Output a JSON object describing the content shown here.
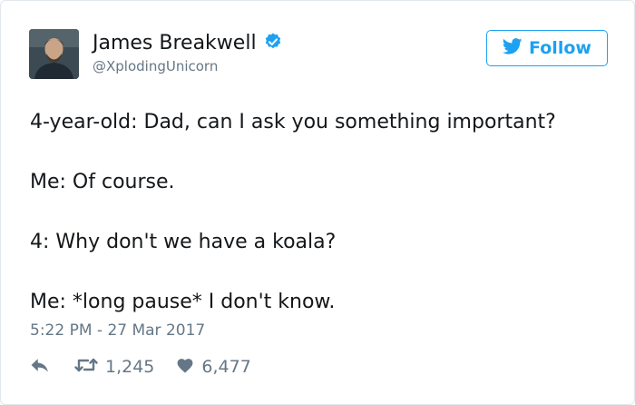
{
  "author": {
    "name": "James Breakwell",
    "handle": "@XplodingUnicorn",
    "verified": true
  },
  "follow_button": {
    "label": "Follow",
    "icon": "twitter-bird-icon"
  },
  "tweet": {
    "lines": [
      "4-year-old: Dad, can I ask you something important?",
      "Me: Of course.",
      "4: Why don't we have a koala?",
      "Me: *long pause* I don't know."
    ]
  },
  "timestamp": "5:22 PM - 27 Mar 2017",
  "stats": {
    "retweets": "1,245",
    "likes": "6,477"
  },
  "colors": {
    "accent": "#1da1f2",
    "text": "#14171a",
    "muted": "#657786",
    "border": "#e1e8ed"
  },
  "icons": {
    "reply": "reply-icon",
    "retweet": "retweet-icon",
    "like": "heart-icon",
    "verified": "verified-badge-icon"
  }
}
